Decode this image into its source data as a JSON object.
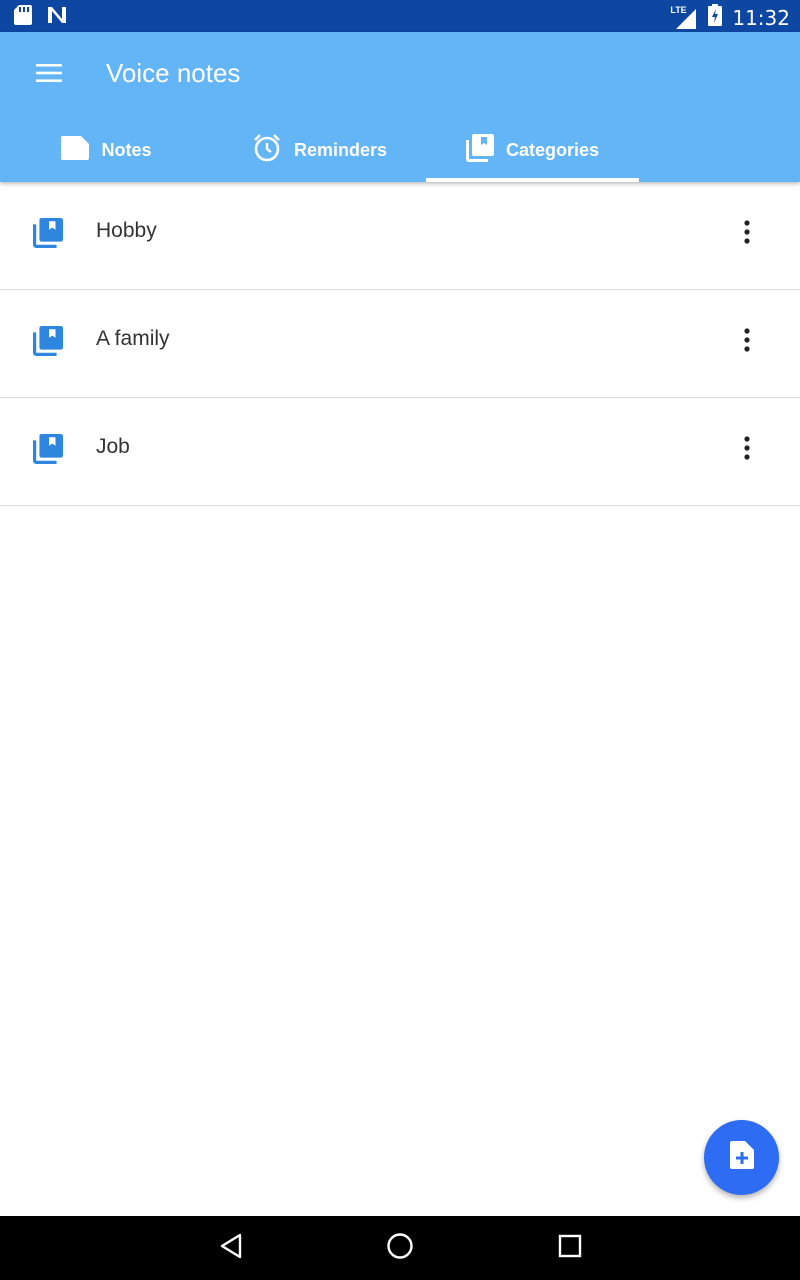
{
  "status_bar": {
    "time": "11:32",
    "network": "LTE",
    "icons": [
      "sd-card-icon",
      "n-notification-icon",
      "lte-signal-icon",
      "battery-charging-icon"
    ]
  },
  "app_bar": {
    "title": "Voice notes",
    "menu_icon": "hamburger-menu-icon"
  },
  "tabs": [
    {
      "label": "Notes",
      "icon": "note-icon",
      "selected": false
    },
    {
      "label": "Reminders",
      "icon": "alarm-clock-icon",
      "selected": false
    },
    {
      "label": "Categories",
      "icon": "category-icon",
      "selected": true
    }
  ],
  "categories": [
    {
      "label": "Hobby",
      "icon": "category-icon"
    },
    {
      "label": "A family",
      "icon": "category-icon"
    },
    {
      "label": "Job",
      "icon": "category-icon"
    }
  ],
  "fab": {
    "icon": "add-note-icon"
  },
  "colors": {
    "status_bar": "#0d47a1",
    "app_bar": "#64b5f6",
    "accent": "#2e6cf4",
    "category_icon": "#2e86de"
  },
  "nav_bar": {
    "icons": [
      "back-icon",
      "home-icon",
      "recents-icon"
    ]
  }
}
